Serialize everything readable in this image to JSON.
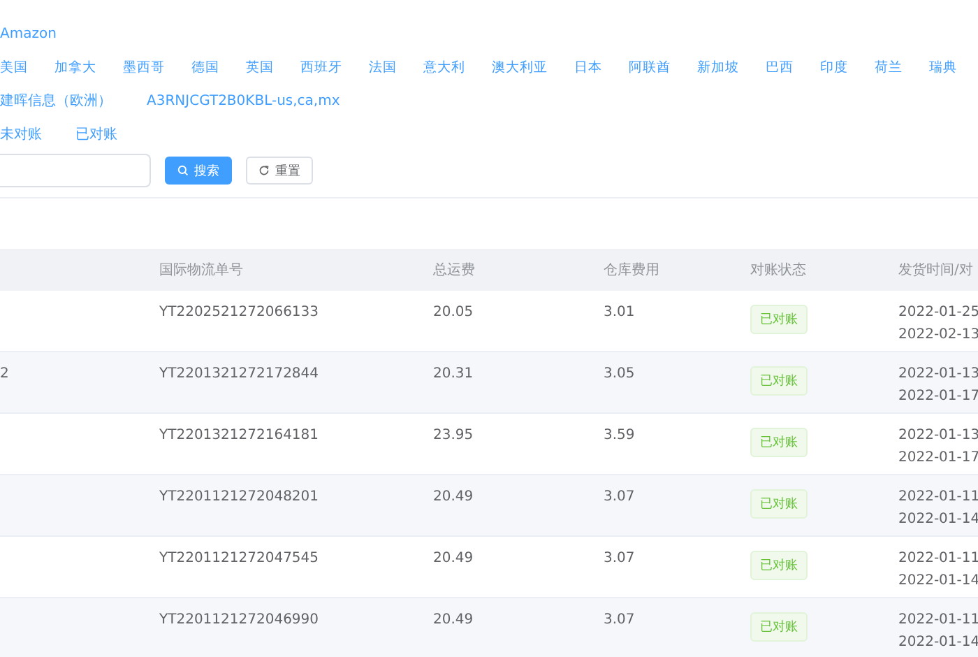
{
  "platform": "Amazon",
  "countries": [
    "美国",
    "加拿大",
    "墨西哥",
    "德国",
    "英国",
    "西班牙",
    "法国",
    "意大利",
    "澳大利亚",
    "日本",
    "阿联酋",
    "新加坡",
    "巴西",
    "印度",
    "荷兰",
    "瑞典"
  ],
  "stores": [
    "建晖信息（欧洲）",
    "A3RNJCGT2B0KBL-us,ca,mx"
  ],
  "statuses": [
    "未对账",
    "已对账"
  ],
  "buttons": [
    {
      "kind": "primary",
      "label": "搜索"
    },
    {
      "kind": "default",
      "label": "重置"
    }
  ],
  "table": {
    "columns": [
      "国际物流单号",
      "总运费",
      "仓库费用",
      "对账状态",
      "发货时间/对"
    ],
    "rows": [
      {
        "column_1": "",
        "tracking": "YT2202521272066133",
        "freight": "20.05",
        "warehouse_fee": "3.01",
        "status": "已对账",
        "dates": [
          "2022-01-25",
          "2022-02-13"
        ]
      },
      {
        "column_1": "2",
        "tracking": "YT2201321272172844",
        "freight": "20.31",
        "warehouse_fee": "3.05",
        "status": "已对账",
        "dates": [
          "2022-01-13",
          "2022-01-17"
        ]
      },
      {
        "column_1": "",
        "tracking": "YT2201321272164181",
        "freight": "23.95",
        "warehouse_fee": "3.59",
        "status": "已对账",
        "dates": [
          "2022-01-13",
          "2022-01-17"
        ]
      },
      {
        "column_1": "",
        "tracking": "YT2201121272048201",
        "freight": "20.49",
        "warehouse_fee": "3.07",
        "status": "已对账",
        "dates": [
          "2022-01-11",
          "2022-01-14"
        ]
      },
      {
        "column_1": "",
        "tracking": "YT2201121272047545",
        "freight": "20.49",
        "warehouse_fee": "3.07",
        "status": "已对账",
        "dates": [
          "2022-01-11",
          "2022-01-14"
        ]
      },
      {
        "column_1": "",
        "tracking": "YT2201121272046990",
        "freight": "20.49",
        "warehouse_fee": "3.07",
        "status": "已对账",
        "dates": [
          "2022-01-11",
          "2022-01-14"
        ]
      }
    ]
  }
}
